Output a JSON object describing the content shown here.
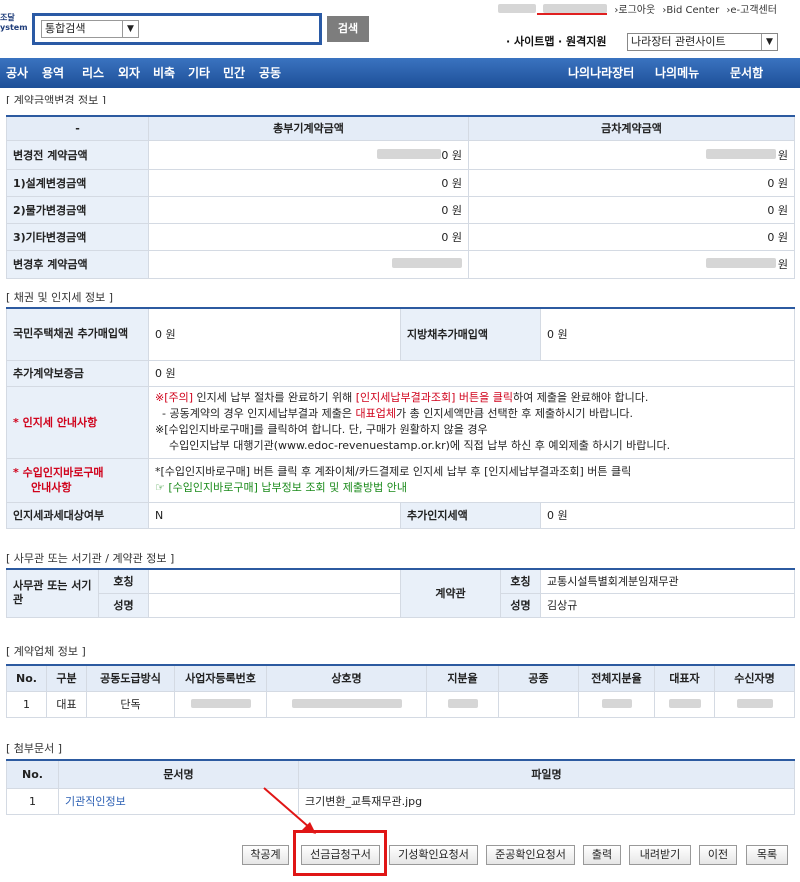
{
  "header": {
    "logo_text": [
      "조달",
      "ystem"
    ],
    "search_select": "통합검색",
    "search_button": "검색",
    "top_links": [
      "›로그아웃",
      "›Bid Center",
      "›e-고객센터"
    ],
    "sitemap": "· 사이트맵",
    "remote_support": "· 원격지원",
    "site_select": "나라장터 관련사이트"
  },
  "nav": {
    "left": [
      "공사",
      "용역",
      "리스",
      "외자",
      "비축",
      "기타",
      "민간",
      "공동"
    ],
    "right": [
      "나의나라장터",
      "나의메뉴",
      "문서함"
    ]
  },
  "amount_section": {
    "title": "[ 계약금액변경 정보 ]",
    "columns": [
      "-",
      "총부기계약금액",
      "금차계약금액"
    ],
    "rows": [
      {
        "label": "변경전 계약금액",
        "total": "0 원",
        "current": "원"
      },
      {
        "label": "1)설계변경금액",
        "total": "0 원",
        "current": "0 원"
      },
      {
        "label": "2)물가변경금액",
        "total": "0 원",
        "current": "0 원"
      },
      {
        "label": "3)기타변경금액",
        "total": "0 원",
        "current": "0 원"
      },
      {
        "label": "변경후 계약금액",
        "total": "",
        "current": "원"
      }
    ]
  },
  "bond_section": {
    "title": "[ 채권 및 인지세 정보 ]",
    "housing_bond_label": "국민주택채권 추가매입액",
    "housing_bond_value": "0 원",
    "local_bond_label": "지방채추가매입액",
    "local_bond_value": "0 원",
    "extra_deposit_label": "추가계약보증금",
    "extra_deposit_value": "0 원",
    "stamp_guide_label": "인지세 안내사항",
    "stamp_guide_notice_prefix": "※[주의]",
    "stamp_guide_notice_red": "[인지세납부결과조회] 버튼을 클릭",
    "stamp_guide_notice_mid": "인지세 납부 절차를 완료하기 위해",
    "stamp_guide_notice_suffix": "하여 제출을 완료해야 합니다.",
    "stamp_guide_line2_a": "- 공동계약의 경우 인지세납부결과 제출은",
    "stamp_guide_line2_red": "대표업체",
    "stamp_guide_line2_b": "가 총 인지세액만큼 선택한 후 제출하시기 바랍니다.",
    "stamp_guide_line3": "※[수입인지바로구매]를 클릭하여 합니다. 단, 구매가 원활하지 않을 경우",
    "stamp_guide_line4": "수입인지납부 대행기관(www.edoc-revenuestamp.or.kr)에 직접 납부 하신 후 예외제출 하시기 바랍니다.",
    "revenue_stamp_label_1": "수입인지바로구매",
    "revenue_stamp_label_2": "안내사항",
    "revenue_stamp_line1": "*[수입인지바로구매] 버튼 클릭 후 계좌이체/카드결제로 인지세 납부 후 [인지세납부결과조회] 버튼 클릭",
    "revenue_stamp_line2": "[수입인지바로구매] 납부정보 조회 및 제출방법 안내",
    "stamp_target_label": "인지세과세대상여부",
    "stamp_target_value": "N",
    "extra_stamp_label": "추가인지세액",
    "extra_stamp_value": "0 원"
  },
  "office_section": {
    "title": "[ 사무관 또는 서기관 / 계약관 정보 ]",
    "officer_label": "사무관 또는 서기관",
    "title_label": "호칭",
    "name_label": "성명",
    "contract_officer_label": "계약관",
    "contract_title_label": "호칭",
    "contract_title_value": "교통시설특별회계분임재무관",
    "contract_name_label": "성명",
    "contract_name_value": "김상규"
  },
  "company_section": {
    "title": "[ 계약업체 정보 ]",
    "columns": [
      "No.",
      "구분",
      "공동도급방식",
      "사업자등록번호",
      "상호명",
      "지분율",
      "공종",
      "전체지분율",
      "대표자",
      "수신자명"
    ],
    "row": {
      "no": "1",
      "type": "대표",
      "method": "단독"
    }
  },
  "docs_section": {
    "title": "[ 첨부문서 ]",
    "columns": [
      "No.",
      "문서명",
      "파일명"
    ],
    "row": {
      "no": "1",
      "doc_name": "기관직인정보",
      "file_name": "크기변환_교특재무관.jpg"
    }
  },
  "buttons": [
    "착공계",
    "선금급청구서",
    "기성확인요청서",
    "준공확인요청서",
    "출력",
    "내려받기",
    "이전",
    "목록"
  ],
  "colors": {
    "nav_bg": "#1d4f98",
    "header_cell": "#e4ecf7",
    "highlight_red": "#e01616",
    "notice_red": "#d0021b",
    "guide_green": "#1a8a1a",
    "link_blue": "#2b5fb3"
  }
}
